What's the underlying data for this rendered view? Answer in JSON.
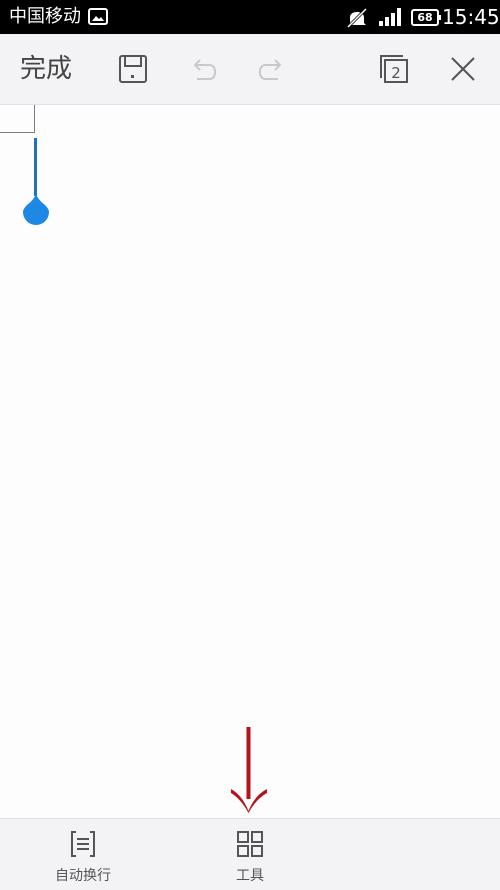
{
  "status_bar": {
    "carrier": "中国移动",
    "battery": "68",
    "time": "15:45"
  },
  "toolbar": {
    "done_label": "完成",
    "page_count": "2"
  },
  "bottom_bar": {
    "wrap_label": "自动换行",
    "tools_label": "工具"
  },
  "colors": {
    "cursor": "#1e88e5",
    "arrow": "#b5121b"
  },
  "icons": [
    "photo-icon",
    "mute-icon",
    "signal-icon",
    "save-icon",
    "undo-icon",
    "redo-icon",
    "pages-icon",
    "close-icon",
    "text-wrap-icon",
    "grid-icon",
    "arrow-down-icon"
  ]
}
